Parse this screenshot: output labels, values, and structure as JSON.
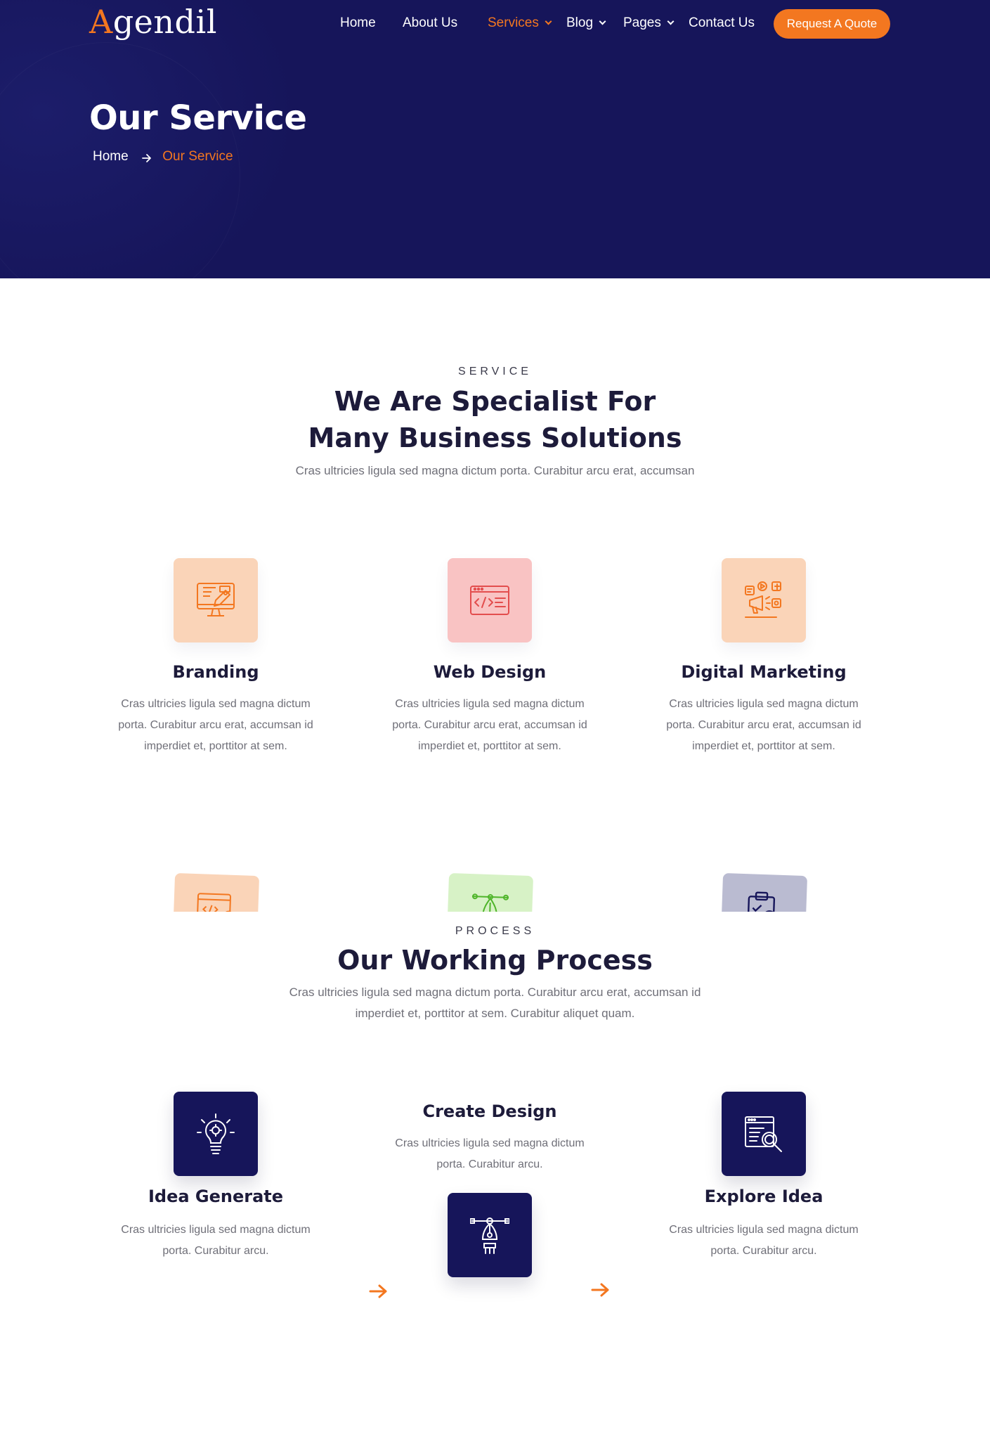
{
  "brand": {
    "logo_first": "A",
    "logo_rest": "gendil"
  },
  "nav": {
    "items": [
      {
        "label": "Home",
        "has_dropdown": false,
        "active": false
      },
      {
        "label": "About Us",
        "has_dropdown": false,
        "active": false
      },
      {
        "label": "Services",
        "has_dropdown": true,
        "active": true
      },
      {
        "label": "Blog",
        "has_dropdown": true,
        "active": false
      },
      {
        "label": "Pages",
        "has_dropdown": true,
        "active": false
      },
      {
        "label": "Contact Us",
        "has_dropdown": false,
        "active": false
      }
    ],
    "cta_label": "Request A Quote"
  },
  "hero": {
    "title": "Our Service",
    "breadcrumb": {
      "home": "Home",
      "current": "Our Service"
    }
  },
  "services": {
    "eyebrow": "SERVICE",
    "title_line1": "We Are Specialist For",
    "title_line2": "Many Business Solutions",
    "subtitle": "Cras ultricies ligula sed magna dictum porta. Curabitur arcu erat, accumsan",
    "cards": [
      {
        "title": "Branding",
        "desc_line1": "Cras ultricies ligula sed magna dictum",
        "desc_line2": "porta. Curabitur arcu erat, accumsan id",
        "desc_line3": "imperdiet et, porttitor at sem.",
        "icon": "branding-monitor-icon",
        "color": "#fad4b8"
      },
      {
        "title": "Web Design",
        "desc_line1": "Cras ultricies ligula sed magna dictum",
        "desc_line2": "porta. Curabitur arcu erat, accumsan id",
        "desc_line3": "imperdiet et, porttitor at sem.",
        "icon": "code-window-icon",
        "color": "#f9c3c3"
      },
      {
        "title": "Digital Marketing",
        "desc_line1": "Cras ultricies ligula sed magna dictum",
        "desc_line2": "porta. Curabitur arcu erat, accumsan id",
        "desc_line3": "imperdiet et, porttitor at sem.",
        "icon": "megaphone-social-icon",
        "color": "#fad4b8"
      }
    ],
    "partial_cards": [
      {
        "icon": "code-settings-icon",
        "color": "#fad4b8"
      },
      {
        "icon": "pen-tool-icon",
        "color": "#d7f2c6"
      },
      {
        "icon": "clipboard-search-icon",
        "color": "#babbd1"
      }
    ]
  },
  "process": {
    "eyebrow": "PROCESS",
    "title": "Our Working Process",
    "subtitle_line1": "Cras ultricies ligula sed magna dictum porta. Curabitur arcu erat, accumsan id",
    "subtitle_line2": "imperdiet et, porttitor at sem. Curabitur aliquet quam.",
    "steps": [
      {
        "title": "Idea Generate",
        "desc_line1": "Cras ultricies ligula sed magna dictum",
        "desc_line2": "porta. Curabitur arcu.",
        "icon": "lightbulb-gear-icon"
      },
      {
        "title": "Create Design",
        "desc_line1": "Cras ultricies ligula sed magna dictum",
        "desc_line2": "porta. Curabitur arcu.",
        "icon": "pen-nib-icon"
      },
      {
        "title": "Explore Idea",
        "desc_line1": "Cras ultricies ligula sed magna dictum",
        "desc_line2": "porta. Curabitur arcu.",
        "icon": "browser-search-icon"
      }
    ]
  },
  "colors": {
    "accent": "#f37720",
    "navy": "#16155a",
    "heading": "#1d1b3a",
    "body_text": "#6f6f78"
  }
}
